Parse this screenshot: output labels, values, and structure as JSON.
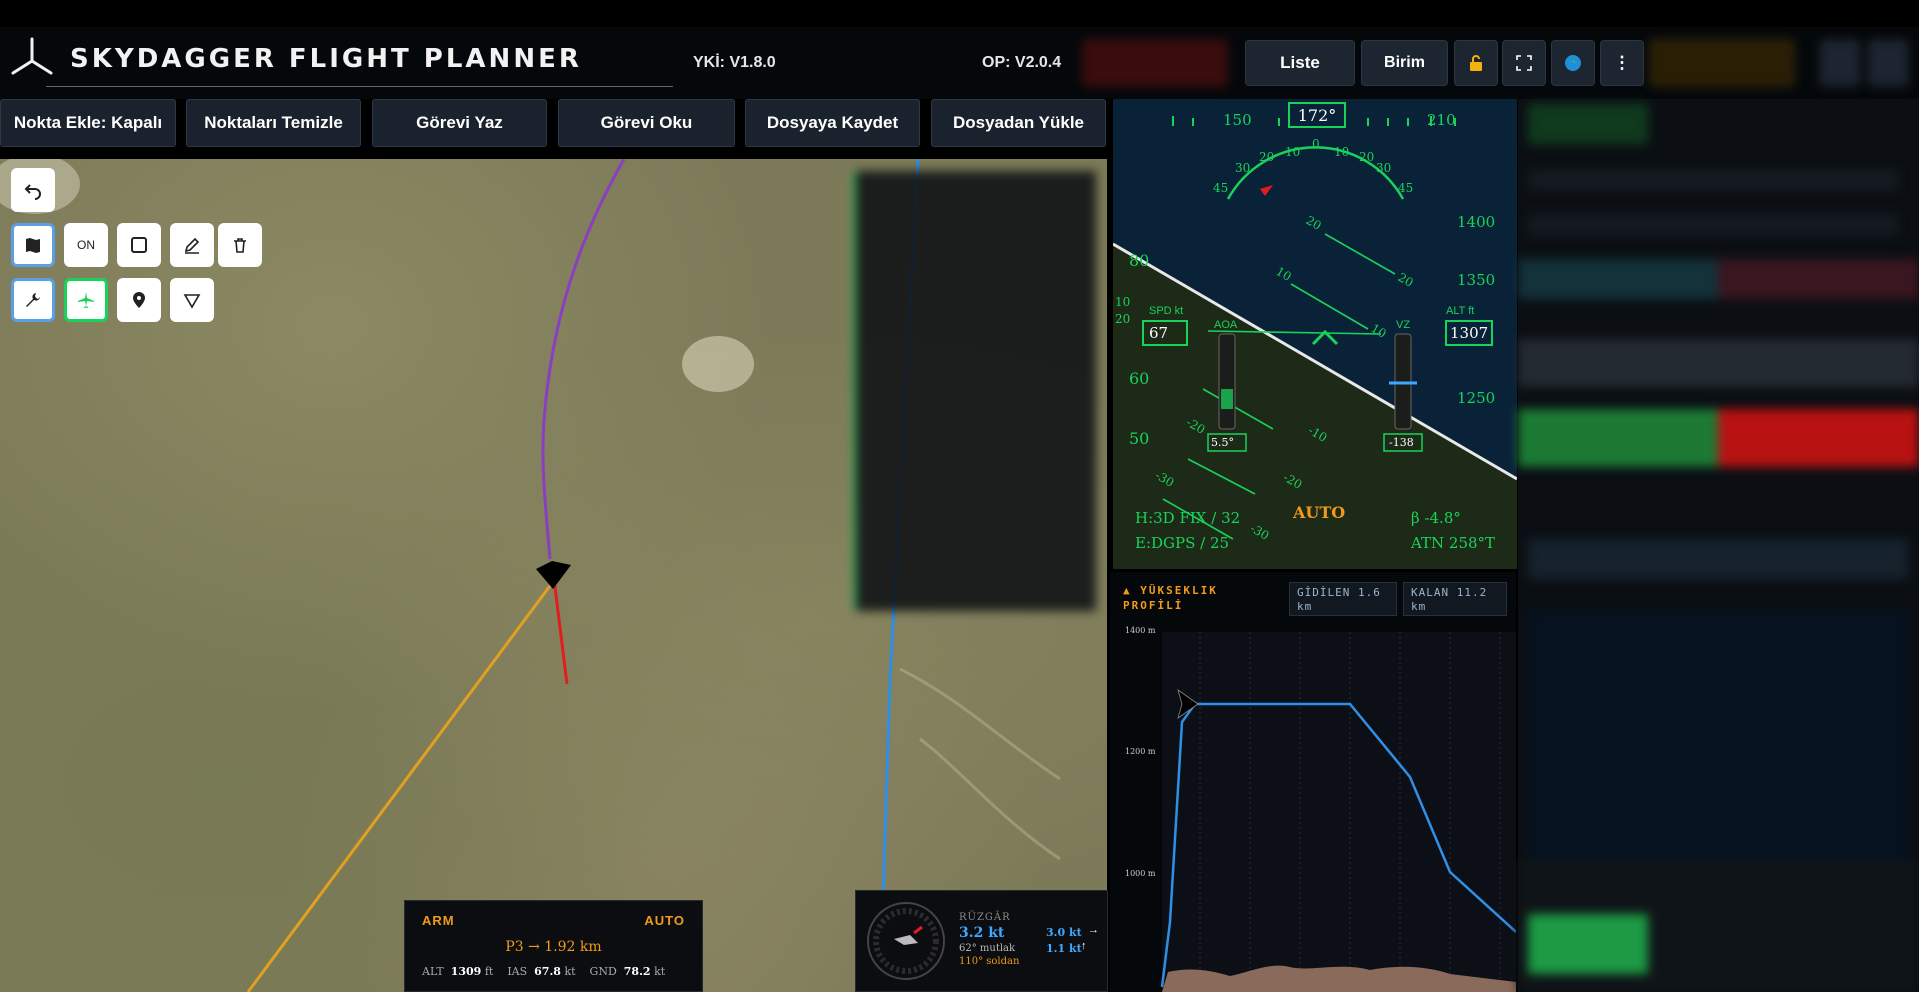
{
  "header": {
    "title": "SKYDAGGER FLIGHT PLANNER",
    "yki_version": "YKİ: V1.8.0",
    "op_version": "OP: V2.0.4",
    "liste_label": "Liste",
    "birim_label": "Birim",
    "more_label": "⋮"
  },
  "toolbar": {
    "add_point": "Nokta Ekle: Kapalı",
    "clear_points": "Noktaları Temizle",
    "write_mission": "Görevi Yaz",
    "read_mission": "Görevi Oku",
    "save_file": "Dosyaya Kaydet",
    "load_file": "Dosyadan Yükle"
  },
  "map_tools": {
    "on_label": "ON"
  },
  "pfd": {
    "heading": "172°",
    "heading_left": "150",
    "heading_right": "210",
    "bank_labels": [
      "45",
      "30",
      "20",
      "10",
      "0",
      "10",
      "20",
      "30",
      "45"
    ],
    "speed_label": "SPD kt",
    "speed_value": "67",
    "speed_ticks": [
      "80",
      "60",
      "50"
    ],
    "alt_label": "ALT ft",
    "alt_value": "1307",
    "alt_ticks": [
      "1400",
      "1350",
      "1250"
    ],
    "pitch_labels": [
      "20",
      "10",
      "10",
      "20",
      "20",
      "10",
      "-10",
      "-20",
      "-20",
      "-30",
      "-30"
    ],
    "aoa_label": "AOA",
    "aoa_value": "5.5°",
    "vz_label": "VZ",
    "vz_value": "-138",
    "gps_h": "H:3D FIX / 32",
    "gps_e": "E:DGPS / 25",
    "mode": "AUTO",
    "beta": "β -4.8°",
    "atn": "ATN 258°T"
  },
  "elevation": {
    "title_line1": "▲ YÜKSEKLIK",
    "title_line2": "PROFİLİ",
    "traveled": "GİDİLEN 1.6 km",
    "remaining": "KALAN 11.2 km",
    "y_ticks": [
      "1400 m",
      "1200 m",
      "1000 m"
    ]
  },
  "status": {
    "arm": "ARM",
    "mode": "AUTO",
    "target": "P3 → 1.92 km",
    "alt_label": "ALT",
    "alt_value": "1309",
    "alt_unit": "ft",
    "ias_label": "IAS",
    "ias_value": "67.8",
    "ias_unit": "kt",
    "gnd_label": "GND",
    "gnd_value": "78.2",
    "gnd_unit": "kt"
  },
  "wind": {
    "title": "RÜZGÂR",
    "speed": "3.2 kt",
    "abs": "62° mutlak",
    "rel": "110° soldan",
    "side_top": "3.0 kt",
    "side_bottom": "1.1 kt"
  },
  "colors": {
    "accent_green": "#19d25a",
    "path_purple": "#8a3fc0",
    "path_orange": "#e2a020",
    "path_red": "#e11d1d",
    "path_blue": "#2f8fe6",
    "pfd_sky": "#0a2238",
    "pfd_ground": "#1e2a18",
    "amber": "#f29a1a"
  }
}
